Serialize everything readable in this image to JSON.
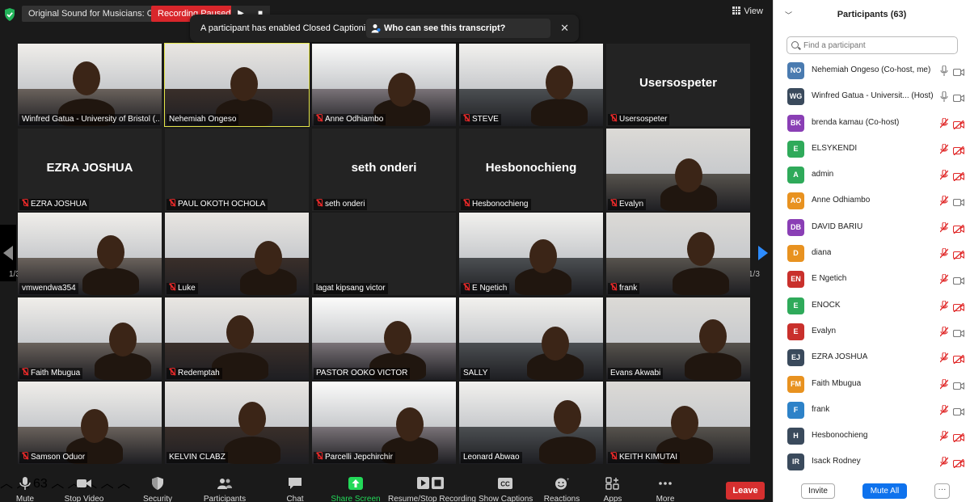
{
  "topbar": {
    "original_sound": "Original Sound for Musicians: Off",
    "recording_status": "Recording Paused",
    "view_label": "View"
  },
  "banner": {
    "message": "A participant has enabled Closed Captioning",
    "who_can_see": "Who can see this transcript? Recording on"
  },
  "pagination": {
    "left": "1/3",
    "right": "1/3"
  },
  "tiles": [
    {
      "name": "Winfred Gatua - University of Bristol (...",
      "muted": false,
      "video": true
    },
    {
      "name": "Nehemiah Ongeso",
      "muted": false,
      "video": true,
      "active": true
    },
    {
      "name": "Anne Odhiambo",
      "muted": true,
      "video": true
    },
    {
      "name": "STEVE",
      "muted": true,
      "video": true
    },
    {
      "name": "Usersospeter",
      "muted": true,
      "video": false,
      "display": "Usersospeter"
    },
    {
      "name": "EZRA JOSHUA",
      "muted": true,
      "video": false,
      "display": "EZRA JOSHUA"
    },
    {
      "name": "PAUL OKOTH OCHOLA",
      "muted": true,
      "video": false,
      "display": ""
    },
    {
      "name": "seth onderi",
      "muted": true,
      "video": false,
      "display": "seth onderi"
    },
    {
      "name": "Hesbonochieng",
      "muted": true,
      "video": false,
      "display": "Hesbonochieng"
    },
    {
      "name": "Evalyn",
      "muted": true,
      "video": true
    },
    {
      "name": "vmwendwa354",
      "muted": false,
      "video": true
    },
    {
      "name": "Luke",
      "muted": true,
      "video": true
    },
    {
      "name": "lagat kipsang victor",
      "muted": false,
      "video": false,
      "display": ""
    },
    {
      "name": "E Ngetich",
      "muted": true,
      "video": true
    },
    {
      "name": "frank",
      "muted": true,
      "video": true
    },
    {
      "name": "Faith Mbugua",
      "muted": true,
      "video": true
    },
    {
      "name": "Redemptah",
      "muted": true,
      "video": true
    },
    {
      "name": "PASTOR OOKO VICTOR",
      "muted": false,
      "video": true
    },
    {
      "name": "SALLY",
      "muted": false,
      "video": true
    },
    {
      "name": "Evans Akwabi",
      "muted": false,
      "video": true
    },
    {
      "name": "Samson Oduor",
      "muted": true,
      "video": true
    },
    {
      "name": "KELVIN CLABZ",
      "muted": false,
      "video": true
    },
    {
      "name": "Parcelli Jepchirchir",
      "muted": true,
      "video": true
    },
    {
      "name": "Leonard Abwao",
      "muted": false,
      "video": true
    },
    {
      "name": "KEITH KIMUTAI",
      "muted": true,
      "video": true
    }
  ],
  "toolbar": {
    "mute": "Mute",
    "stop_video": "Stop Video",
    "security": "Security",
    "participants": "Participants",
    "participants_count": "63",
    "chat": "Chat",
    "share_screen": "Share Screen",
    "recording": "Resume/Stop Recording",
    "captions": "Show Captions",
    "reactions": "Reactions",
    "apps": "Apps",
    "more": "More",
    "leave": "Leave"
  },
  "panel": {
    "title": "Participants (63)",
    "search_placeholder": "Find a participant",
    "participants": [
      {
        "initials": "NO",
        "name": "Nehemiah Ongeso  (Co-host, me)",
        "color": "#4a7bb0",
        "muted": false,
        "video_off": false
      },
      {
        "initials": "WG",
        "name": "Winfred Gatua - Universit...  (Host)",
        "color": "#3a4a5c",
        "muted": false,
        "video_off": false
      },
      {
        "initials": "BK",
        "name": "brenda kamau  (Co-host)",
        "color": "#8a3fb5",
        "muted": true,
        "video_off": true
      },
      {
        "initials": "E",
        "name": "ELSYKENDI",
        "color": "#2faa5a",
        "muted": true,
        "video_off": true
      },
      {
        "initials": "A",
        "name": "admin",
        "color": "#2faa5a",
        "muted": true,
        "video_off": true
      },
      {
        "initials": "AO",
        "name": "Anne Odhiambo",
        "color": "#e89220",
        "muted": true,
        "video_off": false
      },
      {
        "initials": "DB",
        "name": "DAVID BARIU",
        "color": "#8a3fb5",
        "muted": true,
        "video_off": true
      },
      {
        "initials": "D",
        "name": "diana",
        "color": "#e89220",
        "muted": true,
        "video_off": true
      },
      {
        "initials": "EN",
        "name": "E Ngetich",
        "color": "#c9302c",
        "muted": true,
        "video_off": false
      },
      {
        "initials": "E",
        "name": "ENOCK",
        "color": "#2faa5a",
        "muted": true,
        "video_off": true
      },
      {
        "initials": "E",
        "name": "Evalyn",
        "color": "#c9302c",
        "muted": true,
        "video_off": false
      },
      {
        "initials": "EJ",
        "name": "EZRA JOSHUA",
        "color": "#3a4a5c",
        "muted": true,
        "video_off": true
      },
      {
        "initials": "FM",
        "name": "Faith Mbugua",
        "color": "#e89220",
        "muted": true,
        "video_off": false
      },
      {
        "initials": "F",
        "name": "frank",
        "color": "#2d82c8",
        "muted": true,
        "video_off": false
      },
      {
        "initials": "H",
        "name": "Hesbonochieng",
        "color": "#3a4a5c",
        "muted": true,
        "video_off": true
      },
      {
        "initials": "IR",
        "name": "Isack Rodney",
        "color": "#3a4a5c",
        "muted": true,
        "video_off": true
      }
    ],
    "invite": "Invite",
    "mute_all": "Mute All",
    "more": "···"
  },
  "colors": {
    "accent": "#0e72ed",
    "recording": "#d8262b",
    "leave": "#d62f2f",
    "share": "#23d959",
    "muted_red": "#e02828"
  }
}
